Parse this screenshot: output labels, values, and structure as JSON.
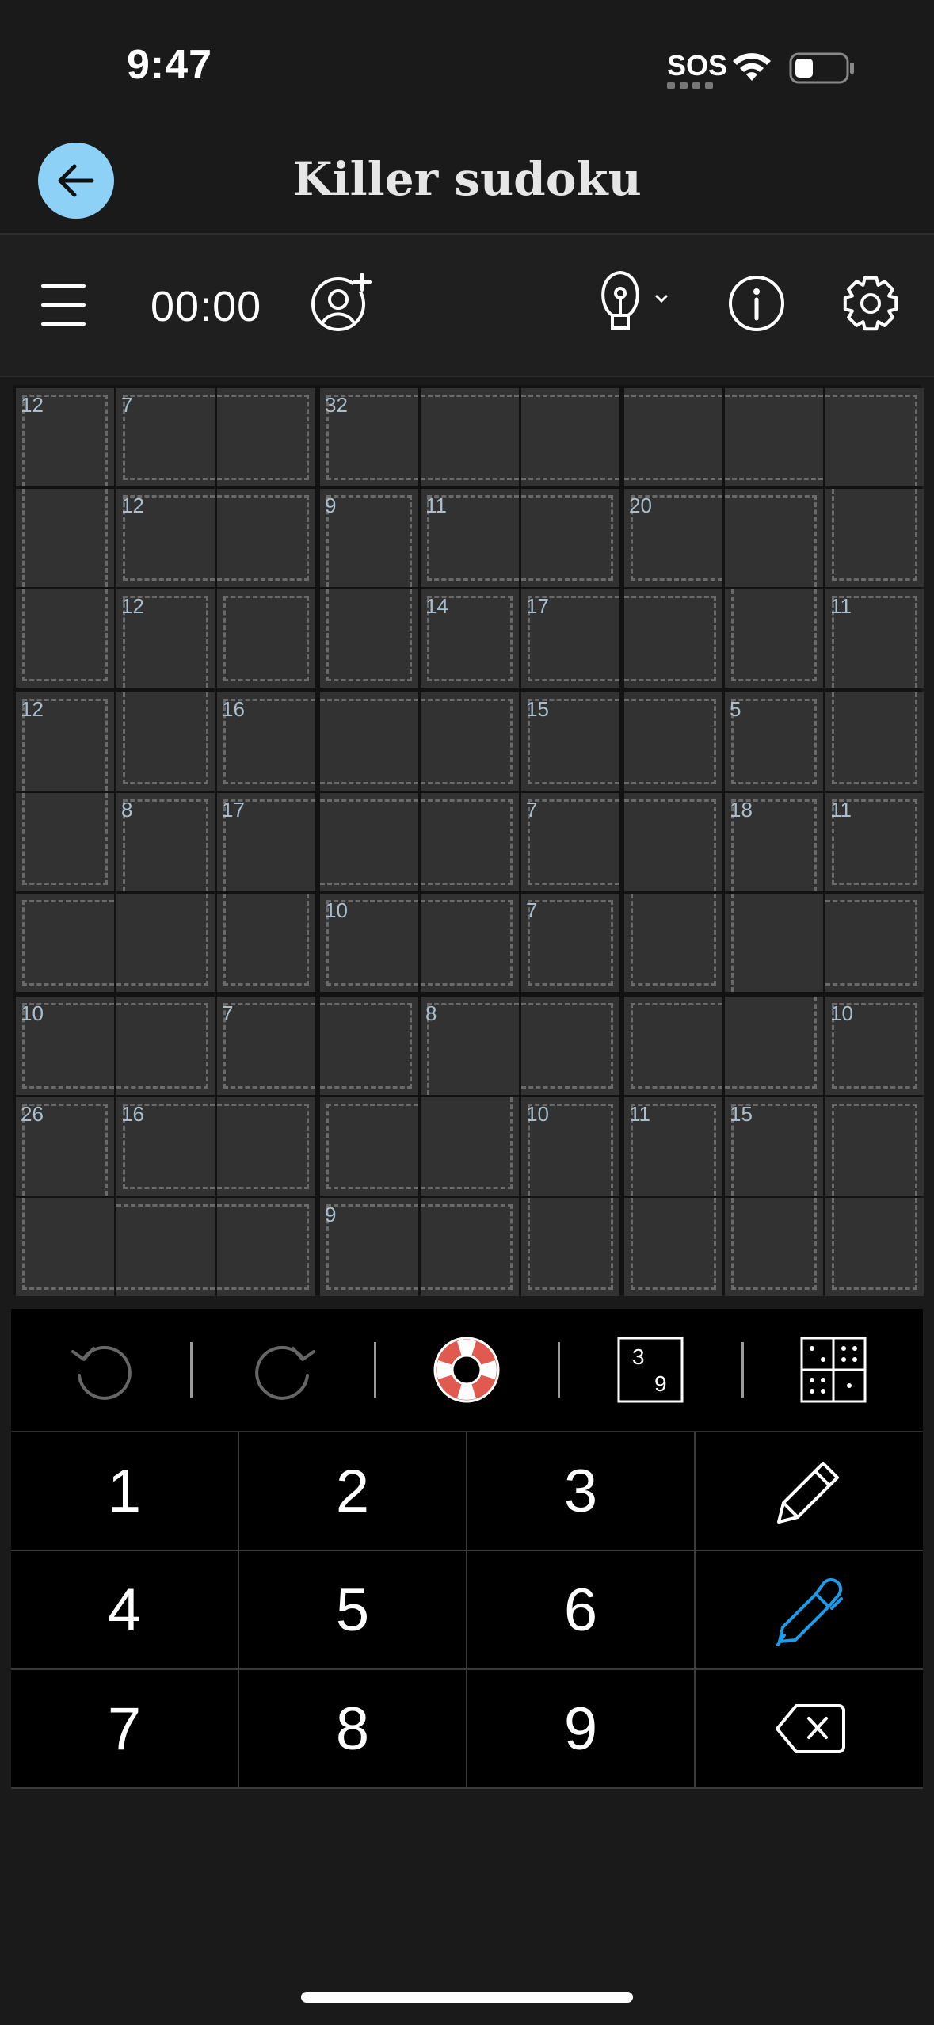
{
  "status": {
    "time": "9:47",
    "sos": "SOS"
  },
  "nav": {
    "title": "Killer sudoku"
  },
  "toolbar": {
    "timer": "00:00"
  },
  "cages": [
    {
      "sum": "12",
      "cells": [
        [
          0,
          0
        ],
        [
          1,
          0
        ],
        [
          2,
          0
        ]
      ]
    },
    {
      "sum": "7",
      "cells": [
        [
          0,
          1
        ],
        [
          0,
          2
        ]
      ]
    },
    {
      "sum": "32",
      "cells": [
        [
          0,
          3
        ],
        [
          0,
          4
        ],
        [
          0,
          5
        ],
        [
          0,
          6
        ],
        [
          0,
          7
        ],
        [
          0,
          8
        ],
        [
          1,
          8
        ]
      ]
    },
    {
      "sum": "12",
      "cells": [
        [
          1,
          1
        ],
        [
          1,
          2
        ]
      ]
    },
    {
      "sum": "9",
      "cells": [
        [
          1,
          3
        ],
        [
          2,
          3
        ]
      ]
    },
    {
      "sum": "11",
      "cells": [
        [
          1,
          4
        ],
        [
          1,
          5
        ]
      ]
    },
    {
      "sum": "20",
      "cells": [
        [
          1,
          6
        ],
        [
          1,
          7
        ],
        [
          2,
          7
        ]
      ]
    },
    {
      "sum": "12",
      "cells": [
        [
          2,
          1
        ],
        [
          3,
          1
        ]
      ]
    },
    {
      "sum": "14",
      "cells": [
        [
          2,
          4
        ]
      ]
    },
    {
      "sum": "17",
      "cells": [
        [
          2,
          5
        ],
        [
          2,
          6
        ]
      ]
    },
    {
      "sum": "11",
      "cells": [
        [
          2,
          8
        ],
        [
          3,
          8
        ]
      ]
    },
    {
      "sum": "12",
      "cells": [
        [
          3,
          0
        ],
        [
          4,
          0
        ]
      ]
    },
    {
      "sum": "16",
      "cells": [
        [
          3,
          2
        ],
        [
          3,
          3
        ],
        [
          3,
          4
        ]
      ]
    },
    {
      "sum": "15",
      "cells": [
        [
          3,
          5
        ],
        [
          3,
          6
        ]
      ]
    },
    {
      "sum": "5",
      "cells": [
        [
          3,
          7
        ]
      ]
    },
    {
      "sum": "8",
      "cells": [
        [
          4,
          1
        ],
        [
          5,
          0
        ],
        [
          5,
          1
        ]
      ]
    },
    {
      "sum": "17",
      "cells": [
        [
          4,
          2
        ],
        [
          5,
          2
        ],
        [
          4,
          3
        ],
        [
          4,
          4
        ]
      ]
    },
    {
      "sum": "7",
      "cells": [
        [
          4,
          6
        ],
        [
          4,
          5
        ],
        [
          5,
          6
        ]
      ]
    },
    {
      "sum": "11",
      "cells": [
        [
          4,
          8
        ]
      ]
    },
    {
      "sum": "10",
      "cells": [
        [
          5,
          3
        ],
        [
          5,
          4
        ]
      ]
    },
    {
      "sum": "7",
      "cells": [
        [
          5,
          5
        ]
      ]
    },
    {
      "sum": "18",
      "cells": [
        [
          5,
          7
        ],
        [
          4,
          7
        ],
        [
          5,
          8
        ],
        [
          6,
          6
        ],
        [
          6,
          7
        ]
      ]
    },
    {
      "sum": "10",
      "cells": [
        [
          6,
          0
        ],
        [
          6,
          1
        ]
      ]
    },
    {
      "sum": "7",
      "cells": [
        [
          6,
          2
        ],
        [
          6,
          3
        ]
      ]
    },
    {
      "sum": "8",
      "cells": [
        [
          6,
          4
        ],
        [
          7,
          4
        ],
        [
          7,
          3
        ],
        [
          6,
          5
        ]
      ]
    },
    {
      "sum": "10",
      "cells": [
        [
          6,
          8
        ]
      ]
    },
    {
      "sum": "26",
      "cells": [
        [
          7,
          0
        ],
        [
          8,
          0
        ],
        [
          8,
          1
        ],
        [
          8,
          2
        ]
      ]
    },
    {
      "sum": "16",
      "cells": [
        [
          7,
          1
        ],
        [
          7,
          2
        ]
      ]
    },
    {
      "sum": "10",
      "cells": [
        [
          7,
          5
        ],
        [
          8,
          5
        ]
      ]
    },
    {
      "sum": "11",
      "cells": [
        [
          7,
          6
        ],
        [
          8,
          6
        ]
      ]
    },
    {
      "sum": "15",
      "cells": [
        [
          7,
          7
        ],
        [
          8,
          7
        ]
      ]
    },
    {
      "sum": "9",
      "cells": [
        [
          8,
          3
        ],
        [
          8,
          4
        ]
      ]
    },
    {
      "sum": "",
      "cells": [
        [
          7,
          8
        ],
        [
          8,
          8
        ]
      ]
    }
  ],
  "keypad": {
    "digits": [
      "1",
      "2",
      "3",
      "4",
      "5",
      "6",
      "7",
      "8",
      "9"
    ]
  },
  "colors": {
    "accent": "#8dd2f6",
    "clue": "#a9bfce",
    "pen_blue": "#1e9be6",
    "lifebuoy": "#e05a4f"
  }
}
